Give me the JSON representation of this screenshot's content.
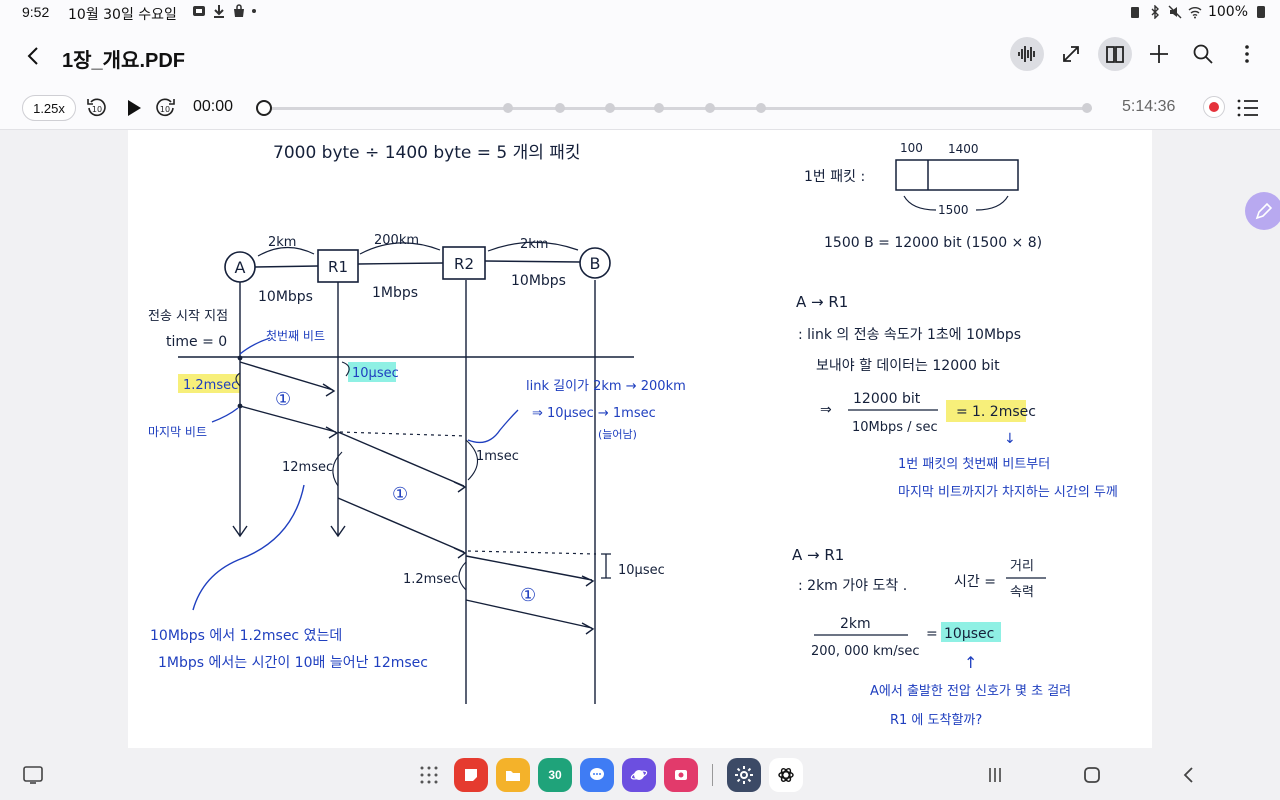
{
  "status": {
    "time": "9:52",
    "date": "10월 30일 수요일",
    "battery": "100%"
  },
  "title": {
    "doc_name": "1장_개요.PDF"
  },
  "player": {
    "speed": "1.25x",
    "rewind_label": "10",
    "forward_label": "10",
    "current_time": "00:00",
    "total_time": "5:14:36",
    "progress": 0
  },
  "note": {
    "top_equation": "7000 byte ÷ 1400 byte = 5 개의 패킷",
    "nodes": {
      "a": "A",
      "r1": "R1",
      "r2": "R2",
      "b": "B"
    },
    "link_top": {
      "ab": "2km",
      "r1r2": "200km",
      "r2b": "2km"
    },
    "link_bottom": {
      "ab": "10Mbps",
      "r1r2": "1Mbps",
      "r2b": "10Mbps"
    },
    "start_label_1": "전송 시작 지점",
    "start_label_2": "time = 0",
    "first_bit": "첫번째 비트",
    "last_bit": "마지막 비트",
    "hl_1_2msec": "1.2msec",
    "prop_10usec": "10μsec",
    "packet_num": "①",
    "link_change_1": "link 길이가 2km → 200km",
    "link_change_2": "⇒ 10μsec → 1msec",
    "link_change_3": "(늘어남)",
    "r2_1msec": "1msec",
    "r1_12msec": "12msec",
    "r2_1_2msec": "1.2msec",
    "b_10usec": "10μsec",
    "bottom_note_1": "10Mbps 에서 1.2msec 였는데",
    "bottom_note_2": "1Mbps 에서는 시간이 10배 늘어난 12msec",
    "packet_label": "1번 패킷 :",
    "packet_header": "100",
    "packet_payload": "1400",
    "packet_total": "1500",
    "bits_eq": "1500 B = 12000 bit (1500 × 8)",
    "ar1_title": "A → R1",
    "ar1_line1": ": link 의 전송 속도가 1초에 10Mbps",
    "ar1_line2": "보내야 할 데이터는 12000 bit",
    "frac1_num": "12000 bit",
    "frac1_den": "10Mbps / sec",
    "frac1_prefix": "⇒",
    "frac1_eq": "=",
    "frac1_result": "1. 2msec",
    "arrow_down": "↓",
    "ar1_blue1": "1번 패킷의 첫번째 비트부터",
    "ar1_blue2": "마지막 비트까지가 차지하는 시간의 두께",
    "ar1b_title": "A → R1",
    "ar1b_line1": ": 2km 가야 도착 .",
    "time_label": "시간 =",
    "time_num": "거리",
    "time_den": "속력",
    "frac2_num": "2km",
    "frac2_den": "200, 000 km/sec",
    "frac2_eq": "=",
    "frac2_result": "10μsec",
    "arrow_up": "↑",
    "ar1b_blue1": "A에서 출발한 전압 신호가 몇 초 걸려",
    "ar1b_blue2": "R1 에 도착할까?"
  },
  "colors": {
    "ink": "#15203a",
    "blue_ink": "#1f3fbf",
    "yellow_highlight": "#f7ef7a",
    "cyan_highlight": "#8ff0e4",
    "fab": "#b8a9f0"
  },
  "nav": {
    "calendar_day": "30"
  }
}
